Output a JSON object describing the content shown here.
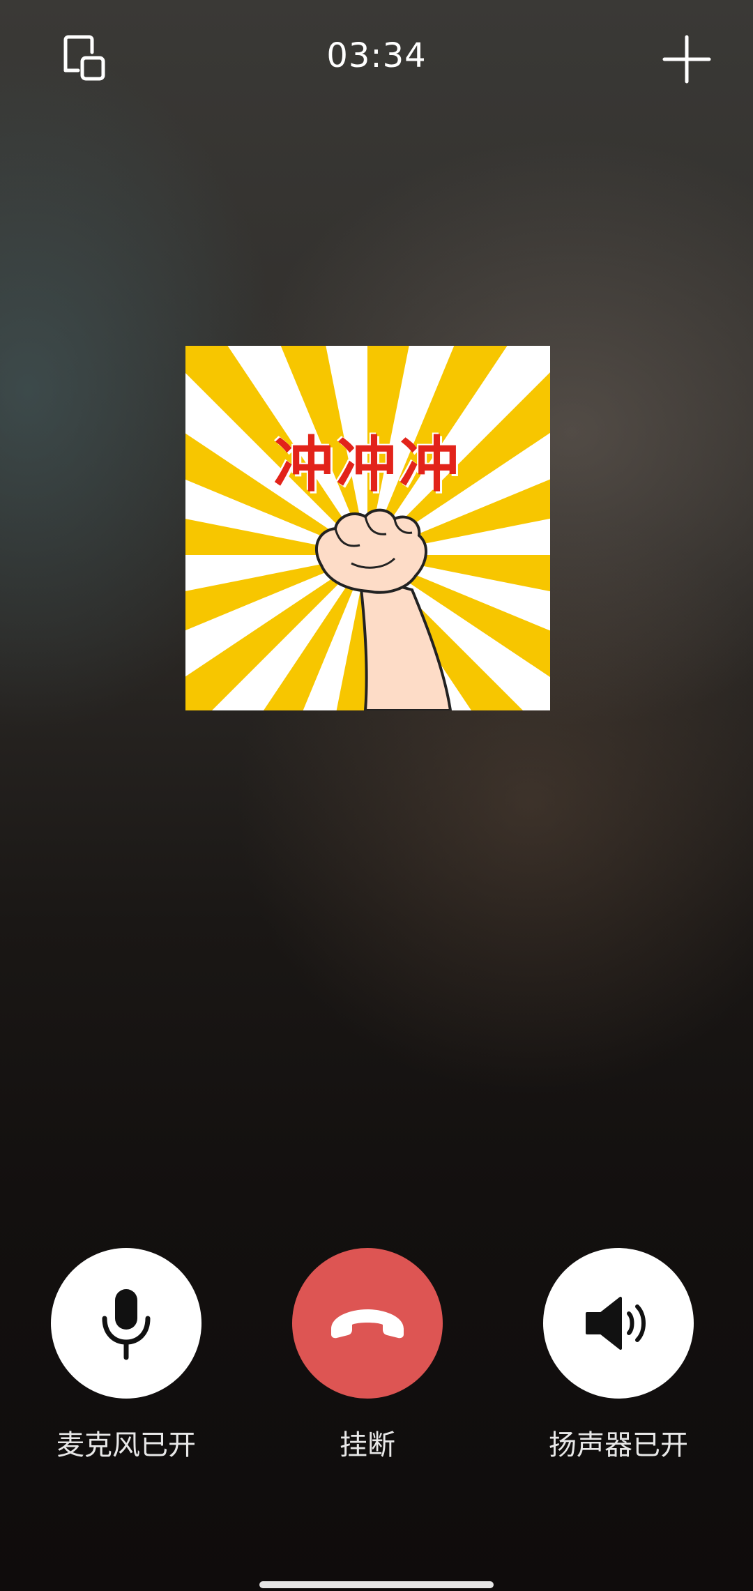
{
  "call": {
    "timer": "03:34",
    "sticker_text": "冲冲冲"
  },
  "icons": {
    "minimize": "picture-in-picture-icon",
    "add": "plus-icon",
    "mic": "microphone-icon",
    "hangup": "phone-hangup-icon",
    "speaker": "speaker-icon"
  },
  "controls": {
    "mic_label": "麦克风已开",
    "hangup_label": "挂断",
    "speaker_label": "扬声器已开"
  },
  "colors": {
    "hangup": "#dd5553",
    "sticker_yellow": "#f7c600",
    "sticker_text": "#e2231a"
  }
}
